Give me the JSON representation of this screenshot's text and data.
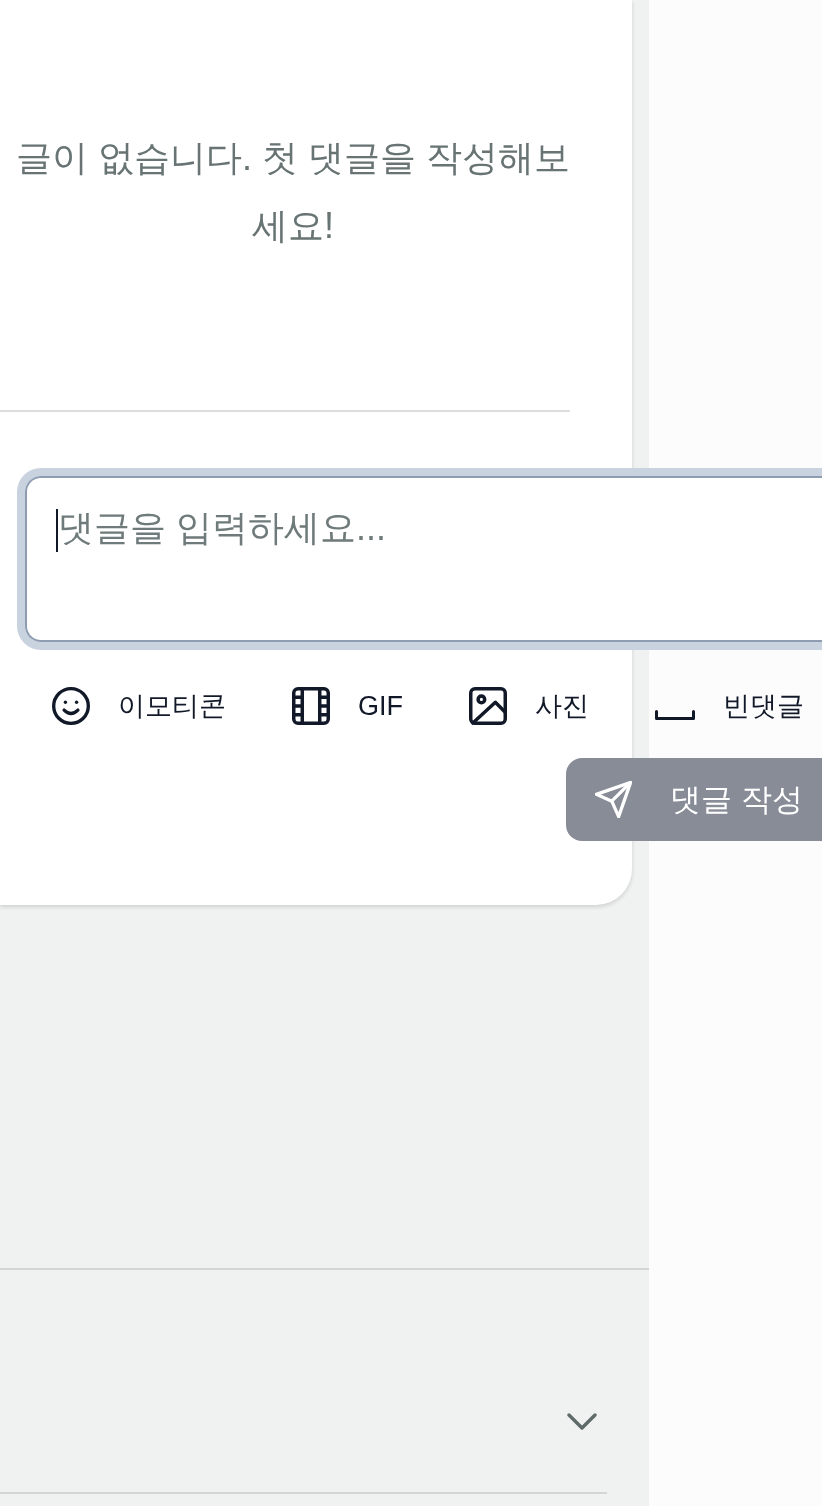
{
  "comments": {
    "empty_message": "글이 없습니다. 첫 댓글을 작성해보세요!"
  },
  "composer": {
    "placeholder": "댓글을 입력하세요...",
    "focused": true
  },
  "toolbar": [
    {
      "kind": "emoji",
      "label": "이모티콘"
    },
    {
      "kind": "gif",
      "label": "GIF"
    },
    {
      "kind": "photo",
      "label": "사진"
    },
    {
      "kind": "blank",
      "label": "빈댓글"
    }
  ],
  "submit": {
    "label": "댓글 작성",
    "disabled": true
  },
  "section": {
    "expanded": false
  }
}
